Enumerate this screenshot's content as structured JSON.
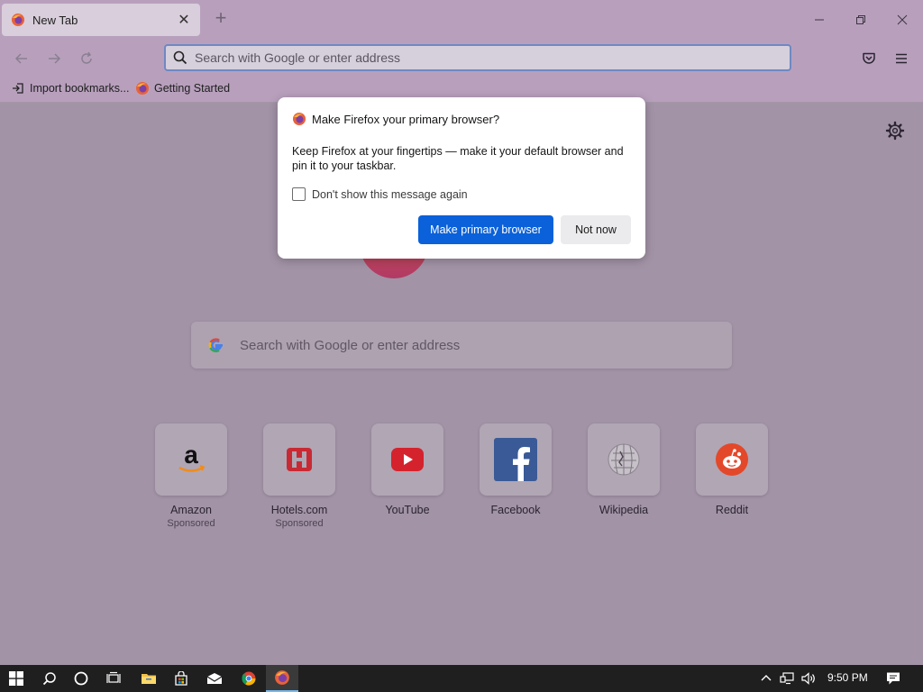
{
  "tab": {
    "title": "New Tab",
    "close_glyph": "✕"
  },
  "new_tab_glyph": "+",
  "urlbar": {
    "placeholder": "Search with Google or enter address"
  },
  "bookmarks": [
    {
      "label": "Import bookmarks...",
      "icon": "import-icon"
    },
    {
      "label": "Getting Started",
      "icon": "firefox-icon"
    }
  ],
  "dialog": {
    "title": "Make Firefox your primary browser?",
    "body": "Keep Firefox at your fingertips — make it your default browser and pin it to your taskbar.",
    "checkbox_label": "Don't show this message again",
    "primary_button": "Make primary browser",
    "secondary_button": "Not now"
  },
  "content_search": {
    "placeholder": "Search with Google or enter address"
  },
  "top_sites": [
    {
      "name": "Amazon",
      "sponsored": "Sponsored"
    },
    {
      "name": "Hotels.com",
      "sponsored": "Sponsored"
    },
    {
      "name": "YouTube",
      "sponsored": ""
    },
    {
      "name": "Facebook",
      "sponsored": ""
    },
    {
      "name": "Wikipedia",
      "sponsored": ""
    },
    {
      "name": "Reddit",
      "sponsored": ""
    }
  ],
  "taskbar": {
    "clock": "9:50 PM"
  },
  "colors": {
    "accent": "#0a61d9",
    "chrome": "#b8a0bd",
    "overlay": "#a293a6"
  }
}
